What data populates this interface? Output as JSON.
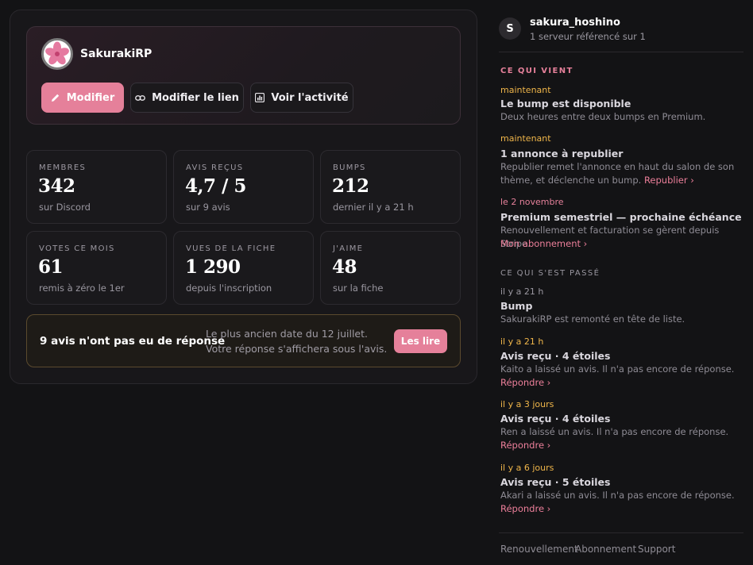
{
  "server": {
    "name": "SakurakiRP",
    "buttons": {
      "edit": "Modifier",
      "edit_link": "Modifier le lien",
      "activity": "Voir l'activité"
    }
  },
  "stats": [
    {
      "label": "MEMBRES",
      "value": "342",
      "sub": "sur Discord"
    },
    {
      "label": "AVIS REÇUS",
      "value": "4,7 / 5",
      "sub": "sur 9 avis"
    },
    {
      "label": "BUMPS",
      "value": "212",
      "sub": "dernier il y a 21 h"
    },
    {
      "label": "VOTES CE MOIS",
      "value": "61",
      "sub": "remis à zéro le 1er"
    },
    {
      "label": "VUES DE LA FICHE",
      "value": "1 290",
      "sub": "depuis l'inscription"
    },
    {
      "label": "J'AIME",
      "value": "48",
      "sub": "sur la fiche"
    }
  ],
  "alert": {
    "title": "9 avis n'ont pas eu de réponse",
    "text": "Le plus ancien date du 12 juillet. Votre réponse s'affichera sous l'avis.",
    "button": "Les lire"
  },
  "user": {
    "initial": "S",
    "name": "sakura_hoshino",
    "sub": "1 serveur référencé sur 1"
  },
  "upcoming": {
    "heading": "CE QUI VIENT",
    "events": [
      {
        "time": "maintenant",
        "title": "Le bump est disponible",
        "desc": "Deux heures entre deux bumps en Premium.",
        "link": ""
      },
      {
        "time": "maintenant",
        "title": "1 annonce à republier",
        "desc": "Republier remet l'annonce en haut du salon de son thème, et déclenche un bump.",
        "link": "Republier ›"
      },
      {
        "time": "le 2 novembre",
        "title": "Premium semestriel — prochaine échéance",
        "desc": "Renouvellement et facturation se gèrent depuis Stripe.",
        "link": "Mon abonnement ›"
      }
    ]
  },
  "past": {
    "heading": "CE QUI S'EST PASSÉ",
    "events": [
      {
        "time": "il y a 21 h",
        "title": "Bump",
        "desc": "SakurakiRP est remonté en tête de liste.",
        "link": ""
      },
      {
        "time": "il y a 21 h",
        "title": "Avis reçu · 4 étoiles",
        "desc": "Kaito a laissé un avis. Il n'a pas encore de réponse.",
        "link": "Répondre ›"
      },
      {
        "time": "il y a 3 jours",
        "title": "Avis reçu · 4 étoiles",
        "desc": "Ren a laissé un avis. Il n'a pas encore de réponse.",
        "link": "Répondre ›"
      },
      {
        "time": "il y a 6 jours",
        "title": "Avis reçu · 5 étoiles",
        "desc": "Akari a laissé un avis. Il n'a pas encore de réponse.",
        "link": "Répondre ›"
      }
    ]
  },
  "footer": [
    "Renouvellement",
    "Abonnement",
    "Support"
  ],
  "colors": {
    "accent": "#e5809a",
    "time_accent": "#f0b64a",
    "background": "#131315"
  }
}
